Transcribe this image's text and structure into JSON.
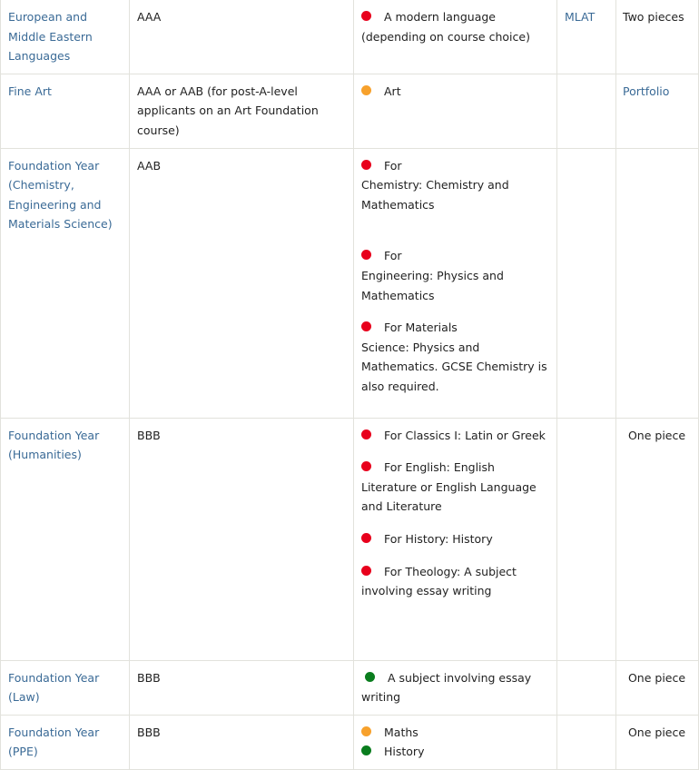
{
  "colors": {
    "red": "#e8001c",
    "orange": "#f7a12c",
    "green": "#0a7d1e",
    "link": "#3a6a96"
  },
  "rows": [
    {
      "course": "European and Middle Eastern Languages",
      "grades": "AAA",
      "subjects": [
        {
          "status": "red",
          "text": "A modern language (depending on course choice)"
        }
      ],
      "test": "MLAT",
      "written_work": "Two pieces"
    },
    {
      "course": "Fine Art",
      "grades": "AAA or AAB (for post-A-level applicants on an Art Foundation course)",
      "subjects": [
        {
          "status": "orange",
          "text": "Art"
        }
      ],
      "test": "",
      "written_work": "Portfolio"
    },
    {
      "course": "Foundation Year (Chemistry, Engineering and Materials Science)",
      "grades": "AAB",
      "subjects": [
        {
          "status": "red",
          "prefix": "For",
          "text": "Chemistry: Chemistry and Mathematics"
        },
        {
          "status": "red",
          "prefix": "For",
          "text": "Engineering: Physics and Mathematics"
        },
        {
          "status": "red",
          "prefix": "For Materials",
          "text": "Science: Physics and Mathematics. GCSE Chemistry is also required."
        }
      ],
      "test": "",
      "written_work": ""
    },
    {
      "course": "Foundation Year (Humanities)",
      "grades": "BBB",
      "subjects": [
        {
          "status": "red",
          "text": "For Classics I: Latin or Greek"
        },
        {
          "status": "red",
          "text": "For English: English Literature or English Language and Literature"
        },
        {
          "status": "red",
          "text": "For History: History"
        },
        {
          "status": "red",
          "text": "For Theology: A subject involving essay writing"
        }
      ],
      "test": "",
      "written_work": "One piece"
    },
    {
      "course": "Foundation Year (Law)",
      "grades": "BBB",
      "subjects": [
        {
          "status": "green",
          "text": "A subject involving essay writing"
        }
      ],
      "test": "",
      "written_work": "One piece"
    },
    {
      "course": "Foundation Year (PPE)",
      "grades": "BBB",
      "subjects": [
        {
          "status": "orange",
          "text": "Maths"
        },
        {
          "status": "green",
          "text": "History"
        }
      ],
      "test": "",
      "written_work": "One piece"
    }
  ]
}
